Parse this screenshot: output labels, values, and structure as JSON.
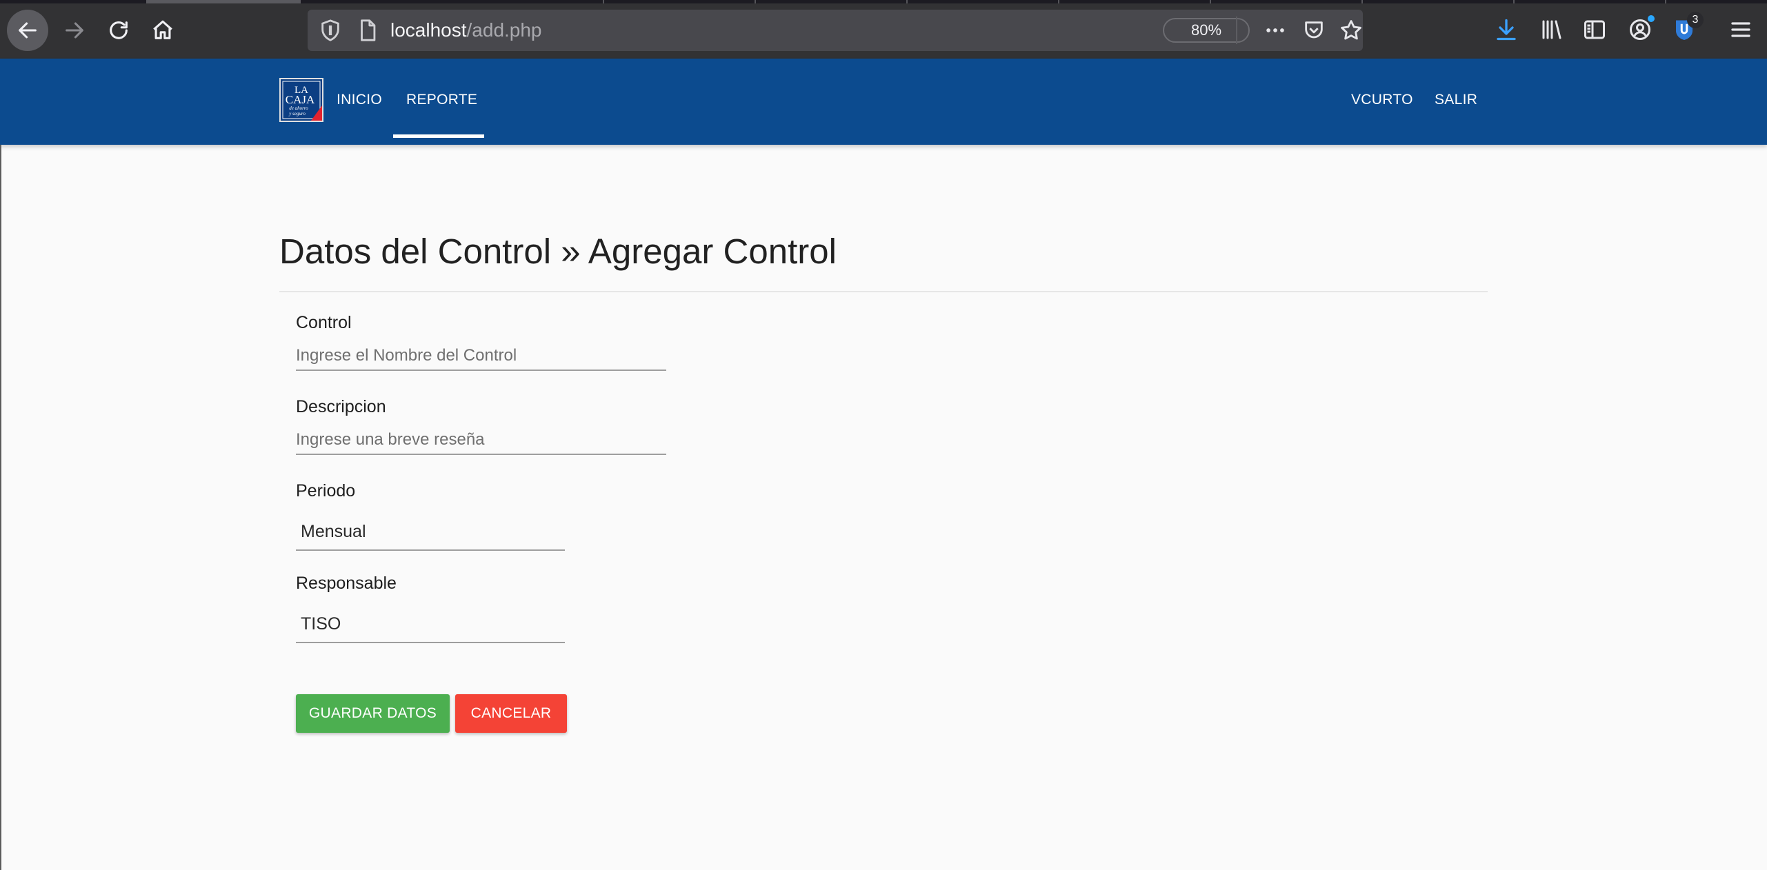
{
  "browser": {
    "url_host": "localhost",
    "url_path": "/add.php",
    "zoom": "80%",
    "extension_badge": "3"
  },
  "navbar": {
    "logo_text": [
      "LA",
      "CAJA",
      "de ahorro",
      "y seguro"
    ],
    "left_links": [
      "INICIO",
      "REPORTE"
    ],
    "active_link": "REPORTE",
    "right_links": [
      "VCURTO",
      "SALIR"
    ]
  },
  "page": {
    "title": "Datos del Control » Agregar Control"
  },
  "form": {
    "control_label": "Control",
    "control_placeholder": "Ingrese el Nombre del Control",
    "descripcion_label": "Descripcion",
    "descripcion_placeholder": "Ingrese una breve reseña",
    "periodo_label": "Periodo",
    "periodo_value": "Mensual",
    "responsable_label": "Responsable",
    "responsable_value": "TISO",
    "save_button": "GUARDAR DATOS",
    "cancel_button": "CANCELAR"
  },
  "colors": {
    "navbar": "#0c4b8f",
    "save": "#4caf50",
    "cancel": "#f44336",
    "chrome": "#323234"
  },
  "icons": [
    "back-icon",
    "forward-icon",
    "reload-icon",
    "home-icon",
    "tracking-shield-icon",
    "page-icon",
    "more-icon",
    "pocket-icon",
    "bookmark-star-icon",
    "download-icon",
    "library-icon",
    "sidebar-icon",
    "account-icon",
    "extension-icon",
    "menu-icon"
  ]
}
